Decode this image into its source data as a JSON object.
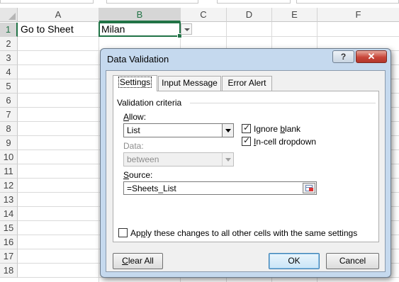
{
  "sheet": {
    "columns": [
      "A",
      "B",
      "C",
      "D",
      "E",
      "F"
    ],
    "selected_column": "B",
    "rows": [
      "1",
      "2",
      "3",
      "4",
      "5",
      "6",
      "7",
      "8",
      "9",
      "10",
      "11",
      "12",
      "13",
      "14",
      "15",
      "16",
      "17",
      "18"
    ],
    "selected_row": "1",
    "cells": {
      "A1": "Go to Sheet",
      "B1": "Milan"
    }
  },
  "dialog": {
    "title": "Data Validation",
    "help_label": "?",
    "close_label": "✕",
    "tabs": [
      "Settings",
      "Input Message",
      "Error Alert"
    ],
    "active_tab": "Settings",
    "group_label": "Validation criteria",
    "allow": {
      "label_pre": "",
      "label_accel": "A",
      "label_post": "llow:",
      "value": "List"
    },
    "ignore_blank": {
      "label_pre": "Ignore ",
      "label_accel": "b",
      "label_post": "lank",
      "checked": true
    },
    "in_cell_dropdown": {
      "label_pre": "",
      "label_accel": "I",
      "label_post": "n-cell dropdown",
      "checked": true
    },
    "data": {
      "label": "Data:",
      "value": "between",
      "disabled": true
    },
    "source": {
      "label_pre": "",
      "label_accel": "S",
      "label_post": "ource:",
      "value": "=Sheets_List"
    },
    "apply_all": {
      "label_pre": "Ap",
      "label_accel": "p",
      "label_post": "ly these changes to all other cells with the same settings",
      "checked": false
    },
    "buttons": {
      "clear_pre": "",
      "clear_accel": "C",
      "clear_post": "lear All",
      "ok": "OK",
      "cancel": "Cancel"
    }
  },
  "colors": {
    "excel_green": "#217346",
    "dialog_frame": "#c5d9ee",
    "close_red": "#c8463a"
  }
}
